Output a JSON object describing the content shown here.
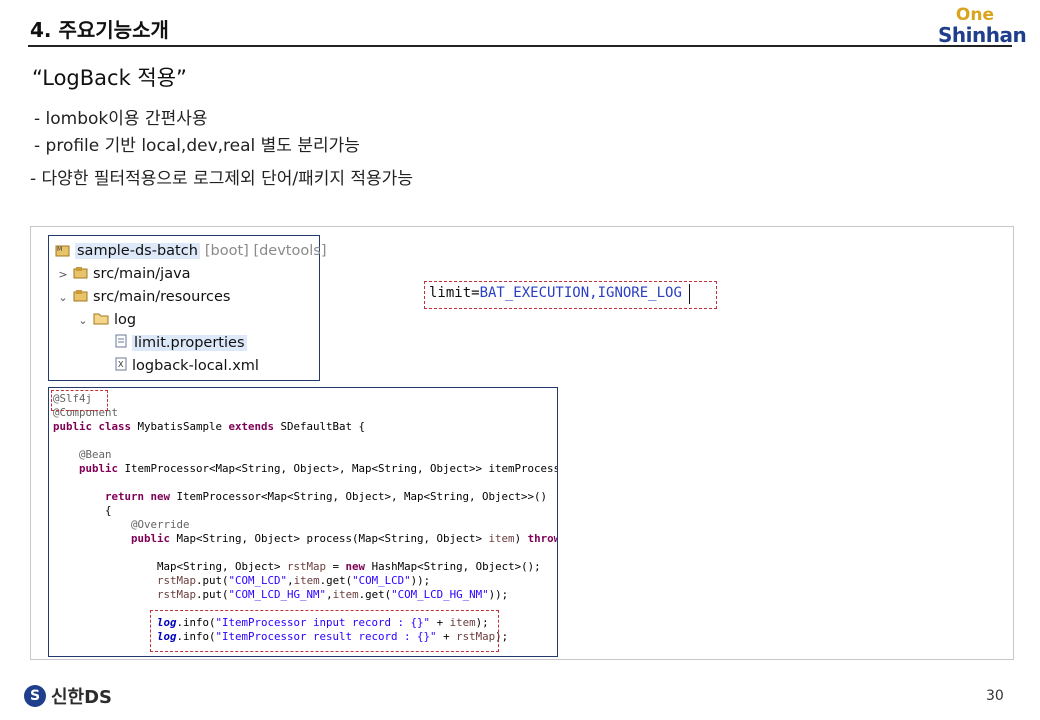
{
  "header": {
    "title": "4. 주요기능소개",
    "logo_top": "One",
    "logo_bottom": "Shinhan"
  },
  "section_title": "“LogBack 적용”",
  "bullets": [
    "- lombok이용 간편사용",
    "- profile 기반 local,dev,real 별도 분리가능",
    "- 다양한 필터적용으로 로그제외 단어/패키지 적용가능"
  ],
  "explorer": {
    "project": "sample-ds-batch",
    "project_suffix": "[boot] [devtools]",
    "items": [
      "src/main/java",
      "src/main/resources",
      "log",
      "limit.properties",
      "logback-local.xml"
    ],
    "selected": "limit.properties"
  },
  "limit_line": {
    "key": "limit=",
    "value": "BAT_EXECUTION,IGNORE_LOG"
  },
  "code": {
    "lines": [
      "@Slf4j",
      "@Component",
      "public class MybatisSample extends SDefaultBat {",
      "",
      "    @Bean",
      "    public ItemProcessor<Map<String, Object>, Map<String, Object>> itemProcessor",
      "",
      "        return new ItemProcessor<Map<String, Object>, Map<String, Object>>()",
      "        {",
      "            @Override",
      "            public Map<String, Object> process(Map<String, Object> item) throws",
      "",
      "                Map<String, Object> rstMap = new HashMap<String, Object>();",
      "                rstMap.put(\"COM_LCD\",item.get(\"COM_LCD\"));",
      "                rstMap.put(\"COM_LCD_HG_NM\",item.get(\"COM_LCD_HG_NM\"));",
      "",
      "                log.info(\"ItemProcessor input record : {}\" + item);",
      "                log.info(\"ItemProcessor result record : {}\" + rstMap);"
    ]
  },
  "footer": {
    "company": "신한DS",
    "logo_glyph": "S",
    "page_number": "30"
  }
}
